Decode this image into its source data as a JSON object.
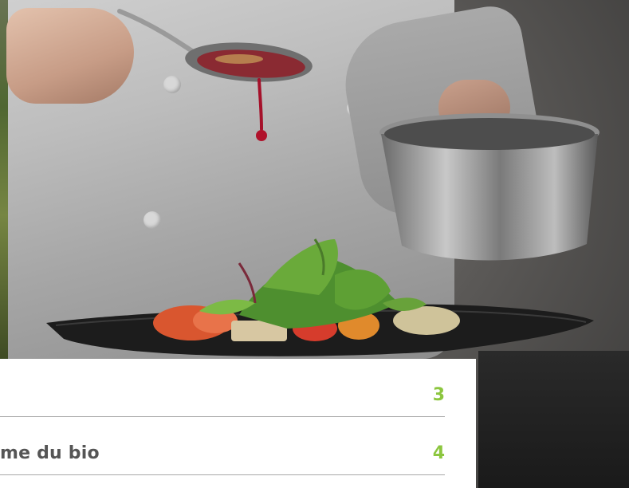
{
  "photo": {
    "subject": "chef-plating-dish",
    "accent_sauce_color": "#b0122b",
    "plate_color": "#1c1c1c"
  },
  "toc": {
    "accent_color": "#8cc63f",
    "text_color": "#555555",
    "entries": [
      {
        "title": "",
        "page": "3"
      },
      {
        "title": "me du bio",
        "page": "4"
      }
    ]
  }
}
